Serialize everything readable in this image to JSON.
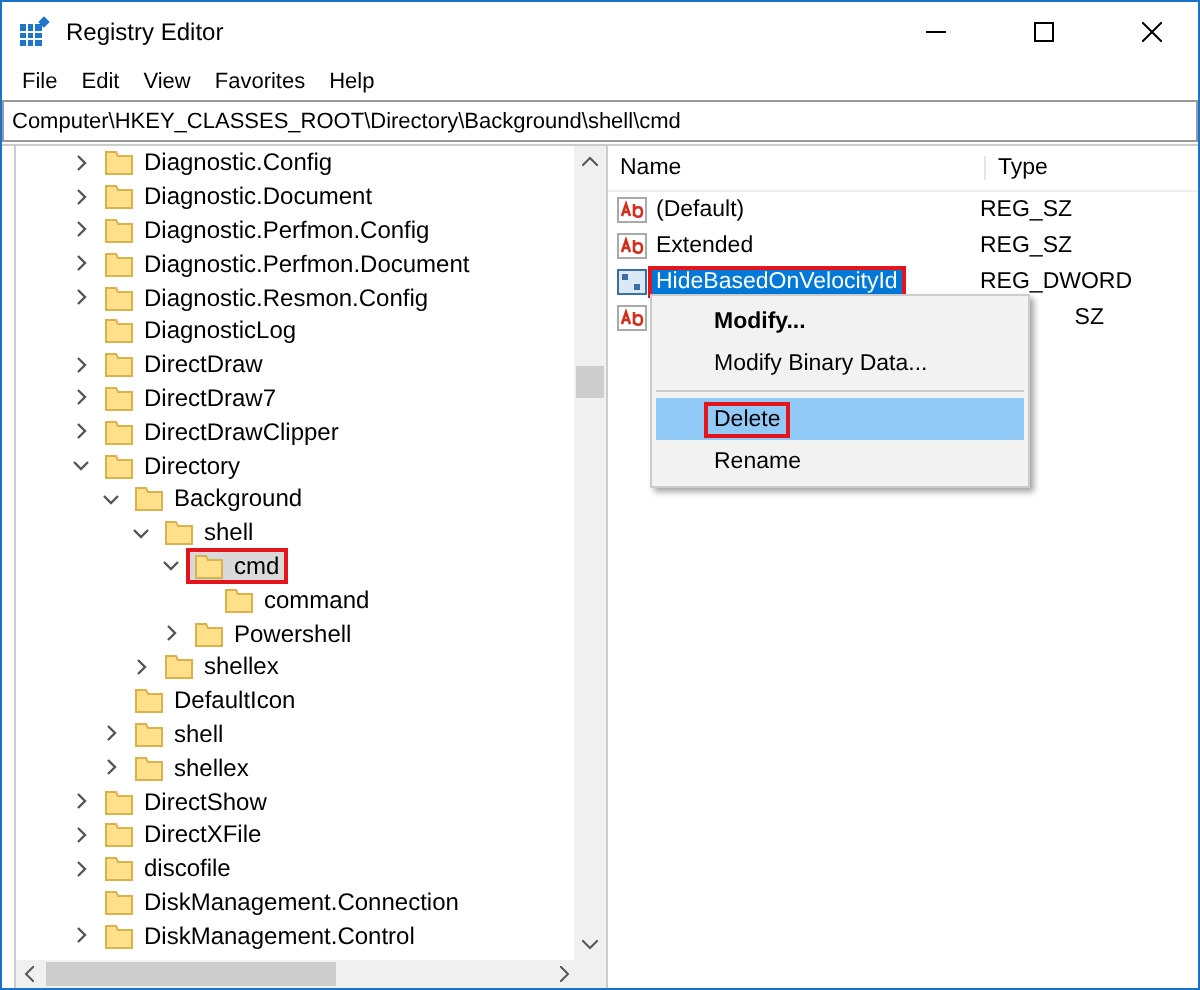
{
  "window": {
    "title": "Registry Editor"
  },
  "menu": [
    "File",
    "Edit",
    "View",
    "Favorites",
    "Help"
  ],
  "address": "Computer\\HKEY_CLASSES_ROOT\\Directory\\Background\\shell\\cmd",
  "tree": [
    {
      "label": "Diagnostic.Config",
      "expandable": true,
      "expanded": false,
      "selected": false,
      "annotated": false
    },
    {
      "label": "Diagnostic.Document",
      "expandable": true,
      "expanded": false,
      "selected": false,
      "annotated": false
    },
    {
      "label": "Diagnostic.Perfmon.Config",
      "expandable": true,
      "expanded": false,
      "selected": false,
      "annotated": false
    },
    {
      "label": "Diagnostic.Perfmon.Document",
      "expandable": true,
      "expanded": false,
      "selected": false,
      "annotated": false
    },
    {
      "label": "Diagnostic.Resmon.Config",
      "expandable": true,
      "expanded": false,
      "selected": false,
      "annotated": false
    },
    {
      "label": "DiagnosticLog",
      "expandable": false,
      "selected": false,
      "annotated": false
    },
    {
      "label": "DirectDraw",
      "expandable": true,
      "expanded": false,
      "selected": false,
      "annotated": false
    },
    {
      "label": "DirectDraw7",
      "expandable": true,
      "expanded": false,
      "selected": false,
      "annotated": false
    },
    {
      "label": "DirectDrawClipper",
      "expandable": true,
      "expanded": false,
      "selected": false,
      "annotated": false
    },
    {
      "label": "Directory",
      "expandable": true,
      "expanded": true,
      "selected": false,
      "annotated": false,
      "children": [
        {
          "label": "Background",
          "expandable": true,
          "expanded": true,
          "selected": false,
          "annotated": false,
          "children": [
            {
              "label": "shell",
              "expandable": true,
              "expanded": true,
              "selected": false,
              "annotated": false,
              "children": [
                {
                  "label": "cmd",
                  "expandable": true,
                  "expanded": true,
                  "selected": true,
                  "annotated": true,
                  "children": [
                    {
                      "label": "command",
                      "expandable": false,
                      "selected": false,
                      "annotated": false
                    }
                  ]
                },
                {
                  "label": "Powershell",
                  "expandable": true,
                  "expanded": false,
                  "selected": false,
                  "annotated": false
                }
              ]
            },
            {
              "label": "shellex",
              "expandable": true,
              "expanded": false,
              "selected": false,
              "annotated": false
            }
          ]
        },
        {
          "label": "DefaultIcon",
          "expandable": false,
          "selected": false,
          "annotated": false
        },
        {
          "label": "shell",
          "expandable": true,
          "expanded": false,
          "selected": false,
          "annotated": false
        },
        {
          "label": "shellex",
          "expandable": true,
          "expanded": false,
          "selected": false,
          "annotated": false
        }
      ]
    },
    {
      "label": "DirectShow",
      "expandable": true,
      "expanded": false,
      "selected": false,
      "annotated": false
    },
    {
      "label": "DirectXFile",
      "expandable": true,
      "expanded": false,
      "selected": false,
      "annotated": false
    },
    {
      "label": "discofile",
      "expandable": true,
      "expanded": false,
      "selected": false,
      "annotated": false
    },
    {
      "label": "DiskManagement.Connection",
      "expandable": false,
      "selected": false,
      "annotated": false
    },
    {
      "label": "DiskManagement.Control",
      "expandable": true,
      "expanded": false,
      "selected": false,
      "annotated": false
    }
  ],
  "columns": [
    "Name",
    "Type"
  ],
  "values": [
    {
      "kind": "string",
      "name": "(Default)",
      "type": "REG_SZ",
      "selected": false,
      "annotated": false
    },
    {
      "kind": "string",
      "name": "Extended",
      "type": "REG_SZ",
      "selected": false,
      "annotated": false
    },
    {
      "kind": "binary",
      "name": "HideBasedOnVelocityId",
      "type": "REG_DWORD",
      "selected": true,
      "annotated": true
    },
    {
      "kind": "string",
      "type": "SZ"
    }
  ],
  "context_menu": [
    {
      "label": "Modify...",
      "default": true,
      "highlighted": false,
      "annotated": false
    },
    {
      "label": "Modify Binary Data...",
      "default": false,
      "highlighted": false,
      "annotated": false,
      "separator_after": true
    },
    {
      "label": "Delete",
      "default": false,
      "highlighted": true,
      "annotated": true
    },
    {
      "label": "Rename",
      "default": false,
      "highlighted": false,
      "annotated": false
    }
  ]
}
